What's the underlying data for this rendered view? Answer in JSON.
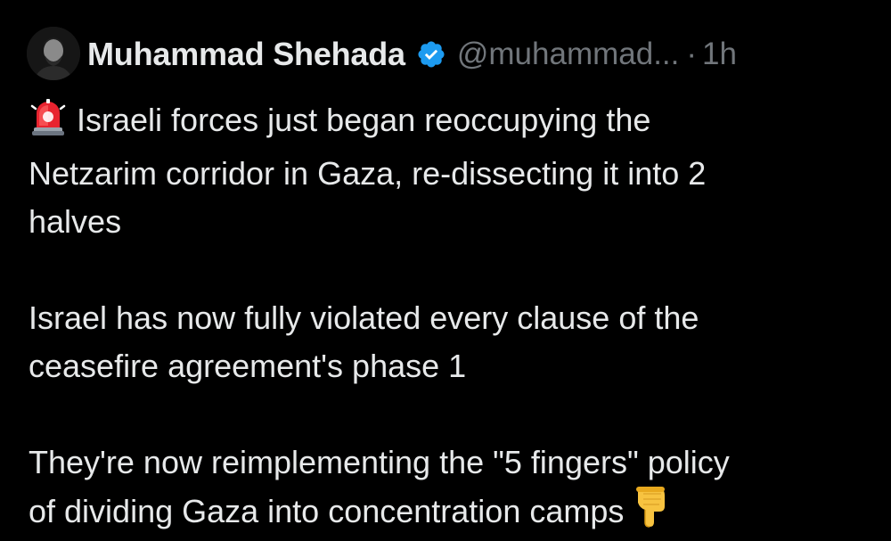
{
  "author": {
    "name": "Muhammad Shehada",
    "handle": "@muhammad...",
    "separator": "·",
    "time": "1h",
    "verified_icon": "verified-badge-icon",
    "verified_color": "#1d9bf0"
  },
  "tweet": {
    "line1_text": "Israeli forces just began reoccupying the",
    "line1_icon": "police-siren-icon",
    "line2": "Netzarim corridor in Gaza, re-dissecting it into 2",
    "line3": "halves",
    "para2_line1": "Israel has now fully violated every clause of the",
    "para2_line2": "ceasefire agreement's phase 1",
    "para3_line1": "They're now reimplementing the \"5 fingers\" policy",
    "para3_line2": "of dividing Gaza into concentration camps",
    "para3_icon": "pointing-down-hand-icon"
  },
  "colors": {
    "background": "#000000",
    "text": "#e7e9ea",
    "muted": "#71767b"
  }
}
